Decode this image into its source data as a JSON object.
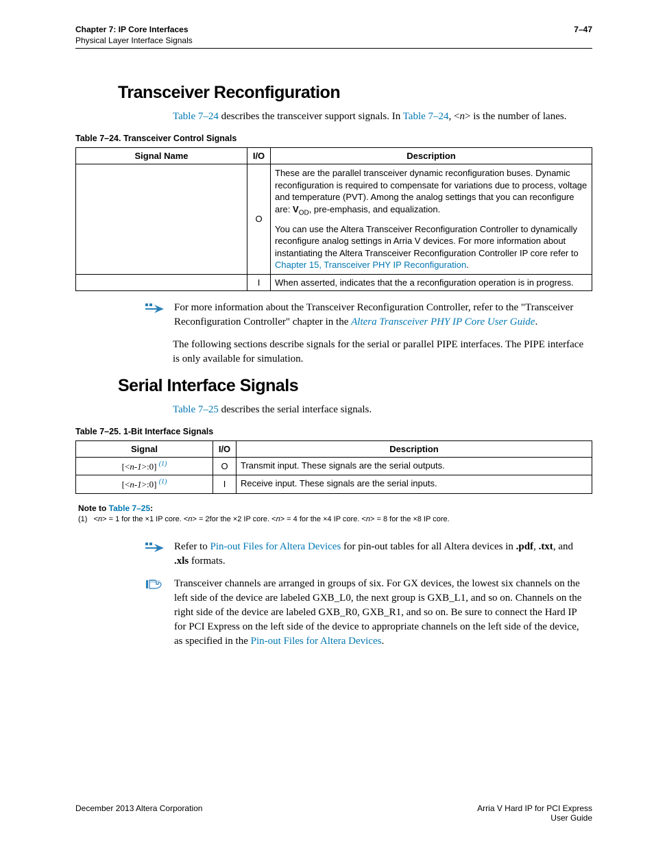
{
  "header": {
    "chapter": "Chapter 7: IP Core Interfaces",
    "sub": "Physical Layer Interface Signals",
    "pagenum": "7–47"
  },
  "section1": {
    "title": "Transceiver Reconfiguration",
    "intro_pre": "Table 7–24",
    "intro_mid": " describes the transceiver support signals. In ",
    "intro_link2": "Table 7–24",
    "intro_post": ", <",
    "intro_n": "n",
    "intro_end": "> is the number of lanes."
  },
  "table24": {
    "caption": "Table 7–24.  Transceiver Control Signals",
    "h1": "Signal Name",
    "h2": "I/O",
    "h3": "Description",
    "r1": {
      "io": "O",
      "p1a": "These are the parallel transceiver dynamic reconfiguration buses. Dynamic reconfiguration is required to compensate for variations due to process, voltage and temperature (PVT). Among the analog settings that you can reconfigure are: ",
      "p1_vod": "V",
      "p1_odsub": "OD",
      "p1b": ", pre-emphasis, and equalization.",
      "p2a": "You can use the Altera Transceiver Reconfiguration Controller to dynamically reconfigure analog settings in Arria V devices. For more information about instantiating the Altera Transceiver Reconfiguration Controller IP core refer to ",
      "p2_link": "Chapter 15, Transceiver PHY IP Reconfiguration",
      "p2b": "."
    },
    "r2": {
      "io": "I",
      "desc": "When asserted, indicates that the a reconfiguration operation is in progress."
    }
  },
  "note1": {
    "t1": "For more information about the Transceiver Reconfiguration Controller, refer to the \"Transceiver Reconfiguration Controller\" chapter in the ",
    "link": "Altera Transceiver PHY IP Core User Guide",
    "t2": "."
  },
  "para_pipe": "The following sections describe signals for the serial or parallel PIPE interfaces. The PIPE interface is only available for simulation.",
  "section2": {
    "title": "Serial Interface Signals",
    "intro_pre": "Table 7–25",
    "intro_post": " describes the serial interface signals."
  },
  "table25": {
    "caption": "Table 7–25.  1-Bit Interface Signals",
    "h1": "Signal",
    "h2": "I/O",
    "h3": "Description",
    "r1": {
      "sig_pre": "[<",
      "sig_n": "n-1",
      "sig_post": ">:0] ",
      "sup": "(1)",
      "io": "O",
      "desc": "Transmit input. These signals are the serial outputs."
    },
    "r2": {
      "sig_pre": "[<",
      "sig_n": "n-1",
      "sig_post": ">:0] ",
      "sup": "(1)",
      "io": "I",
      "desc": "Receive input. These signals are the serial inputs."
    }
  },
  "notefoot": {
    "title_pre": "Note to ",
    "title_link": "Table 7–25",
    "title_post": ":",
    "body": "(1)   <n> = 1 for the ×1 IP core. <n> = 2for the ×2 IP core. <n> = 4 for the ×4 IP core. <n> = 8 for the ×8 IP core."
  },
  "note2": {
    "t1": "Refer to ",
    "link": "Pin-out Files for Altera Devices",
    "t2": " for pin-out tables for all Altera devices in ",
    "pdf": ".pdf",
    "sep1": ", ",
    "txt": ".txt",
    "sep2": ", and ",
    "xls": ".xls",
    "t3": " formats."
  },
  "note3": {
    "t1": "Transceiver channels are arranged in groups of six. For GX devices, the lowest six channels on the left side of the device are labeled GXB_L0, the next group is GXB_L1, and so on. Channels on the right side of the device are labeled GXB_R0, GXB_R1, and so on. Be sure to connect the Hard IP for PCI Express on the left side of the device to appropriate channels on the left side of the device, as specified in the ",
    "link": "Pin-out Files for Altera Devices",
    "t2": "."
  },
  "footer": {
    "left": "December 2013   Altera Corporation",
    "right1": "Arria V Hard IP for PCI Express",
    "right2": "User Guide"
  }
}
